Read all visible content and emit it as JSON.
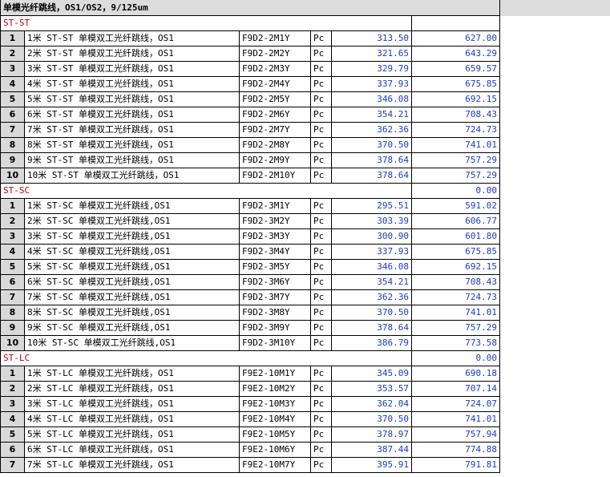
{
  "title": "单模光纤跳线，OS1/OS2，9/125um",
  "sections": [
    {
      "name": "ST-ST",
      "total": "",
      "rows": [
        {
          "idx": "1",
          "desc": "1米 ST-ST 单模双工光纤跳线，OS1",
          "code": "F9D2-2M1Y",
          "unit": "Pc",
          "price": "313.50",
          "amount": "627.00"
        },
        {
          "idx": "2",
          "desc": "2米 ST-ST 单模双工光纤跳线，OS1",
          "code": "F9D2-2M2Y",
          "unit": "Pc",
          "price": "321.65",
          "amount": "643.29"
        },
        {
          "idx": "3",
          "desc": "3米 ST-ST 单模双工光纤跳线，OS1",
          "code": "F9D2-2M3Y",
          "unit": "Pc",
          "price": "329.79",
          "amount": "659.57"
        },
        {
          "idx": "4",
          "desc": "4米 ST-ST 单模双工光纤跳线，OS1",
          "code": "F9D2-2M4Y",
          "unit": "Pc",
          "price": "337.93",
          "amount": "675.85"
        },
        {
          "idx": "5",
          "desc": "5米 ST-ST 单模双工光纤跳线，OS1",
          "code": "F9D2-2M5Y",
          "unit": "Pc",
          "price": "346.08",
          "amount": "692.15"
        },
        {
          "idx": "6",
          "desc": "6米 ST-ST 单模双工光纤跳线，OS1",
          "code": "F9D2-2M6Y",
          "unit": "Pc",
          "price": "354.21",
          "amount": "708.43"
        },
        {
          "idx": "7",
          "desc": "7米 ST-ST 单模双工光纤跳线，OS1",
          "code": "F9D2-2M7Y",
          "unit": "Pc",
          "price": "362.36",
          "amount": "724.73"
        },
        {
          "idx": "8",
          "desc": "8米 ST-ST 单模双工光纤跳线，OS1",
          "code": "F9D2-2M8Y",
          "unit": "Pc",
          "price": "370.50",
          "amount": "741.01"
        },
        {
          "idx": "9",
          "desc": "9米 ST-ST 单模双工光纤跳线，OS1",
          "code": "F9D2-2M9Y",
          "unit": "Pc",
          "price": "378.64",
          "amount": "757.29"
        },
        {
          "idx": "10",
          "desc": "10米 ST-ST 单模双工光纤跳线，OS1",
          "code": "F9D2-2M10Y",
          "unit": "Pc",
          "price": "378.64",
          "amount": "757.29"
        }
      ]
    },
    {
      "name": "ST-SC",
      "total": "0.00",
      "rows": [
        {
          "idx": "1",
          "desc": "1米 ST-SC 单模双工光纤跳线,OS1",
          "code": "F9D2-3M1Y",
          "unit": "Pc",
          "price": "295.51",
          "amount": "591.02"
        },
        {
          "idx": "2",
          "desc": "2米 ST-SC 单模双工光纤跳线,OS1",
          "code": "F9D2-3M2Y",
          "unit": "Pc",
          "price": "303.39",
          "amount": "606.77"
        },
        {
          "idx": "3",
          "desc": "3米 ST-SC 单模双工光纤跳线,OS1",
          "code": "F9D2-3M3Y",
          "unit": "Pc",
          "price": "300.90",
          "amount": "601.80"
        },
        {
          "idx": "4",
          "desc": "4米 ST-SC 单模双工光纤跳线,OS1",
          "code": "F9D2-3M4Y",
          "unit": "Pc",
          "price": "337.93",
          "amount": "675.85"
        },
        {
          "idx": "5",
          "desc": "5米 ST-SC 单模双工光纤跳线,OS1",
          "code": "F9D2-3M5Y",
          "unit": "Pc",
          "price": "346.08",
          "amount": "692.15"
        },
        {
          "idx": "6",
          "desc": "6米 ST-SC 单模双工光纤跳线,OS1",
          "code": "F9D2-3M6Y",
          "unit": "Pc",
          "price": "354.21",
          "amount": "708.43"
        },
        {
          "idx": "7",
          "desc": "7米 ST-SC 单模双工光纤跳线,OS1",
          "code": "F9D2-3M7Y",
          "unit": "Pc",
          "price": "362.36",
          "amount": "724.73"
        },
        {
          "idx": "8",
          "desc": "8米 ST-SC 单模双工光纤跳线,OS1",
          "code": "F9D2-3M8Y",
          "unit": "Pc",
          "price": "370.50",
          "amount": "741.01"
        },
        {
          "idx": "9",
          "desc": "9米 ST-SC 单模双工光纤跳线,OS1",
          "code": "F9D2-3M9Y",
          "unit": "Pc",
          "price": "378.64",
          "amount": "757.29"
        },
        {
          "idx": "10",
          "desc": "10米 ST-SC 单模双工光纤跳线,OS1",
          "code": "F9D2-3M10Y",
          "unit": "Pc",
          "price": "386.79",
          "amount": "773.58"
        }
      ]
    },
    {
      "name": "ST-LC",
      "total": "0.00",
      "rows": [
        {
          "idx": "1",
          "desc": "1米 ST-LC 单模双工光纤跳线，OS1",
          "code": "F9E2-10M1Y",
          "unit": "Pc",
          "price": "345.09",
          "amount": "690.18"
        },
        {
          "idx": "2",
          "desc": "2米 ST-LC 单模双工光纤跳线，OS1",
          "code": "F9E2-10M2Y",
          "unit": "Pc",
          "price": "353.57",
          "amount": "707.14"
        },
        {
          "idx": "3",
          "desc": "3米 ST-LC 单模双工光纤跳线，OS1",
          "code": "F9E2-10M3Y",
          "unit": "Pc",
          "price": "362.04",
          "amount": "724.07"
        },
        {
          "idx": "4",
          "desc": "4米 ST-LC 单模双工光纤跳线，OS1",
          "code": "F9E2-10M4Y",
          "unit": "Pc",
          "price": "370.50",
          "amount": "741.01"
        },
        {
          "idx": "5",
          "desc": "5米 ST-LC 单模双工光纤跳线，OS1",
          "code": "F9E2-10M5Y",
          "unit": "Pc",
          "price": "378.97",
          "amount": "757.94"
        },
        {
          "idx": "6",
          "desc": "6米 ST-LC 单模双工光纤跳线，OS1",
          "code": "F9E2-10M6Y",
          "unit": "Pc",
          "price": "387.44",
          "amount": "774.88"
        },
        {
          "idx": "7",
          "desc": "7米 ST-LC 单模双工光纤跳线，OS1",
          "code": "F9E2-10M7Y",
          "unit": "Pc",
          "price": "395.91",
          "amount": "791.81"
        }
      ]
    }
  ]
}
